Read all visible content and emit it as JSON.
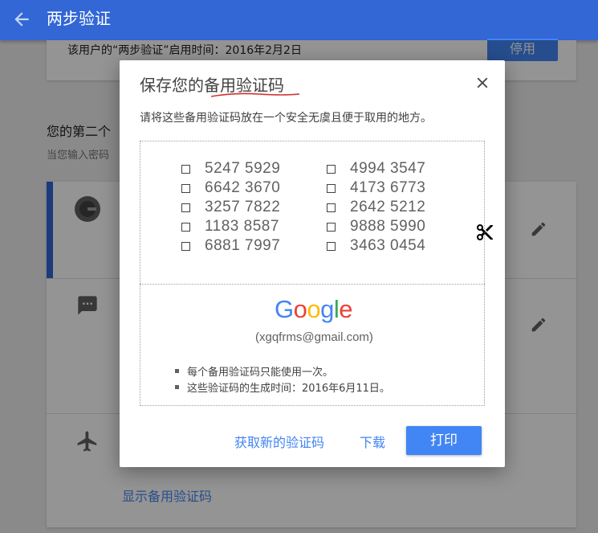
{
  "appbar": {
    "title": "两步验证",
    "back_icon": "arrow-back-icon"
  },
  "enable_card": {
    "text": "该用户的“两步验证”启用时间：2016年2月2日",
    "disable_label": "停用"
  },
  "second_step": {
    "heading": "您的第二个",
    "subtext": "当您输入密码"
  },
  "show_codes_link": "显示备用验证码",
  "dialog": {
    "title": "保存您的备用验证码",
    "description": "请将这些备用验证码放在一个安全无虞且便于取用的地方。",
    "codes_left": [
      "5247 5929",
      "6642 3670",
      "3257 7822",
      "1183 8587",
      "6881 7997"
    ],
    "codes_right": [
      "4994 3547",
      "4173 6773",
      "2642 5212",
      "9888 5990",
      "3463 0454"
    ],
    "google": {
      "G": "G",
      "o1": "o",
      "o2": "o",
      "g": "g",
      "l": "l",
      "e": "e"
    },
    "email": "(xgqfrms@gmail.com)",
    "notes": [
      "每个备用验证码只能使用一次。",
      "这些验证码的生成时间：2016年6月11日。"
    ],
    "get_new_label": "获取新的验证码",
    "download_label": "下载",
    "print_label": "打印"
  },
  "colors": {
    "appbar": "#3367d6",
    "accent": "#4285f4",
    "google_blue": "#4285f4",
    "google_red": "#ea4335",
    "google_yellow": "#fbbc05",
    "google_green": "#34a853"
  }
}
